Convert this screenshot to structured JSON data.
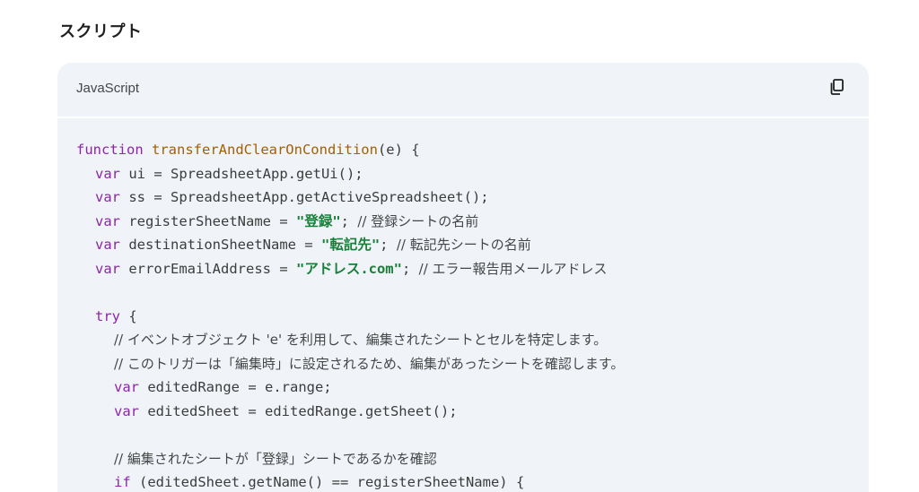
{
  "section": {
    "title": "スクリプト"
  },
  "code_block": {
    "language": "JavaScript",
    "copy_icon": "copy-icon",
    "lines": [
      {
        "kw": "function",
        "fn": "transferAndClearOnCondition",
        "rest": "(e) {"
      },
      {
        "kw": "var",
        "rest": "ui = SpreadsheetApp.getUi();"
      },
      {
        "kw": "var",
        "rest": "ss = SpreadsheetApp.getActiveSpreadsheet();"
      },
      {
        "kw": "var",
        "rest": "registerSheetName = ",
        "str": "\"登録\"",
        "tail": "; ",
        "cmt": "// 登録シートの名前"
      },
      {
        "kw": "var",
        "rest": "destinationSheetName = ",
        "str": "\"転記先\"",
        "tail": "; ",
        "cmt": "// 転記先シートの名前"
      },
      {
        "kw": "var",
        "rest": "errorEmailAddress = ",
        "str": "\"アドレス.com\"",
        "tail": "; ",
        "cmt": "// エラー報告用メールアドレス"
      },
      {
        "blank": ""
      },
      {
        "kw": "try",
        "rest": "{"
      },
      {
        "cmt": "// イベントオブジェクト 'e' を利用して、編集されたシートとセルを特定します。"
      },
      {
        "cmt": "// このトリガーは「編集時」に設定されるため、編集があったシートを確認します。"
      },
      {
        "kw": "var",
        "rest": "editedRange = e.range;"
      },
      {
        "kw": "var",
        "rest": "editedSheet = editedRange.getSheet();"
      },
      {
        "blank": ""
      },
      {
        "cmt": "// 編集されたシートが「登録」シートであるかを確認"
      },
      {
        "kw": "if",
        "rest": "(editedSheet.getName() == registerSheetName) {"
      }
    ]
  }
}
